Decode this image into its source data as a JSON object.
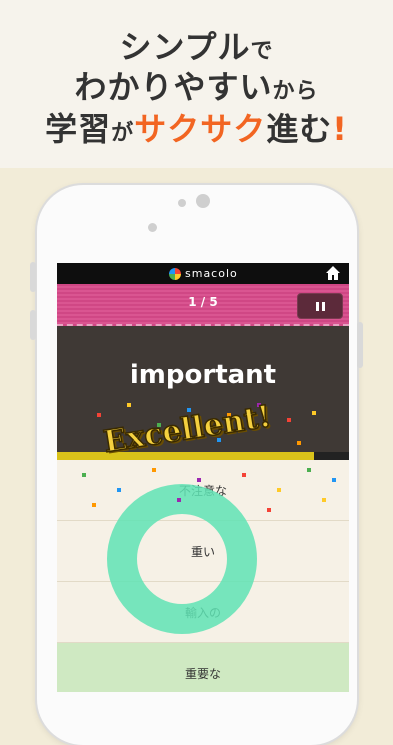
{
  "promo": {
    "line1_main": "シンプル",
    "line1_small": "で",
    "line2_main": "わかりやすい",
    "line2_small": "から",
    "line3_a": "学習",
    "line3_small": "が",
    "line3_accent": "サクサク",
    "line3_b": "進む",
    "line3_exclaim": "!"
  },
  "app": {
    "brand": "smacolo",
    "progress_text": "1 / 5",
    "word": "important",
    "feedback": "Excellent!",
    "timer_remaining": 0.88,
    "options": [
      "不注意な",
      "重い",
      "輸入の",
      "重要な"
    ],
    "correct_index": 3
  },
  "colors": {
    "accent": "#f26522",
    "header": "#d84a8a",
    "card": "#3f3935",
    "ring": "#5fe3b4"
  }
}
